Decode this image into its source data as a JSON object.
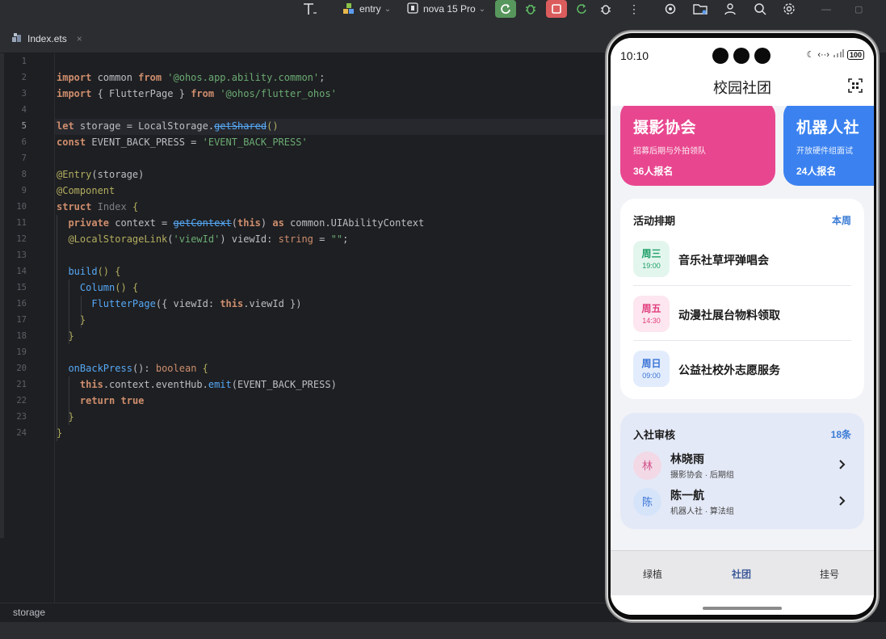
{
  "ide": {
    "toolbar": {
      "module": "entry",
      "device": "nova 15 Pro"
    },
    "tab": {
      "filename": "Index.ets",
      "close": "×"
    },
    "line_numbers": [
      "1",
      "2",
      "3",
      "4",
      "5",
      "6",
      "7",
      "8",
      "9",
      "10",
      "11",
      "12",
      "13",
      "14",
      "15",
      "16",
      "17",
      "18",
      "19",
      "20",
      "21",
      "22",
      "23",
      "24"
    ],
    "current_line": "5",
    "code": {
      "l2": [
        "import",
        " common ",
        "from",
        " '@ohos.app.ability.common'",
        ";"
      ],
      "l3": [
        "import",
        " { FlutterPage } ",
        "from",
        " '@ohos/flutter_ohos'"
      ],
      "l5": [
        "let",
        " storage = LocalStorage.",
        "getShared",
        "()"
      ],
      "l6": [
        "const",
        " EVENT_BACK_PRESS = ",
        "'EVENT_BACK_PRESS'"
      ],
      "l8": [
        "@Entry",
        "(storage)"
      ],
      "l9": [
        "@Component"
      ],
      "l10": [
        "struct",
        " ",
        "Index",
        " {"
      ],
      "l11": [
        "private",
        " context = ",
        "getContext",
        "(",
        "this",
        ") ",
        "as",
        " common.UIAbilityContext"
      ],
      "l12": [
        "@LocalStorageLink",
        "(",
        "'viewId'",
        ") viewId: ",
        "string",
        " = ",
        "\"\"",
        ";"
      ],
      "l14": [
        "build",
        "() {"
      ],
      "l15": [
        "Column",
        "() {"
      ],
      "l16": [
        "FlutterPage",
        "({ viewId: ",
        "this",
        ".viewId })"
      ],
      "l17": [
        "}"
      ],
      "l18": [
        "}"
      ],
      "l20": [
        "onBackPress",
        "(): ",
        "boolean",
        " {"
      ],
      "l21": [
        "this",
        ".context.eventHub.",
        "emit",
        "(EVENT_BACK_PRESS)"
      ],
      "l22": [
        "return",
        " ",
        "true"
      ],
      "l23": [
        "}"
      ],
      "l24": [
        "}"
      ]
    },
    "status": "storage"
  },
  "phone": {
    "time": "10:10",
    "battery": "100",
    "title": "校园社团",
    "clubs": [
      {
        "name": "摄影协会",
        "desc": "招募后期与外拍领队",
        "count": "36人报名",
        "color": "#e8478f"
      },
      {
        "name": "机器人社",
        "desc": "开放硬件组面试",
        "count": "24人报名",
        "color": "#3b82f0"
      }
    ],
    "schedule": {
      "title": "活动排期",
      "link": "本周",
      "events": [
        {
          "day": "周三",
          "time": "19:00",
          "title": "音乐社草坪弹唱会",
          "bg": "#e3f6ee",
          "fg": "#1e9e66"
        },
        {
          "day": "周五",
          "time": "14:30",
          "title": "动漫社展台物料领取",
          "bg": "#fde6ef",
          "fg": "#e0407f"
        },
        {
          "day": "周日",
          "time": "09:00",
          "title": "公益社校外志愿服务",
          "bg": "#e2ecfc",
          "fg": "#3b74d6"
        }
      ]
    },
    "review": {
      "title": "入社审核",
      "count": "18条",
      "members": [
        {
          "initial": "林",
          "name": "林晓雨",
          "sub": "摄影协会 · 后期组",
          "bg": "#f3d8e6",
          "fg": "#d0538a"
        },
        {
          "initial": "陈",
          "name": "陈一航",
          "sub": "机器人社 · 算法组",
          "bg": "#d6e4fa",
          "fg": "#3b74d6"
        }
      ]
    },
    "tabs": [
      "绿植",
      "社团",
      "挂号"
    ],
    "active_tab": "社团"
  }
}
